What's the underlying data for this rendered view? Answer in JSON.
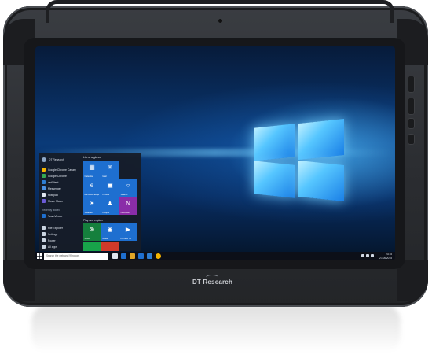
{
  "device": {
    "brand": "DT Research"
  },
  "start_menu": {
    "user": "DT Research",
    "apps": [
      {
        "label": "Google Chrome Canary",
        "color": "#f4b400"
      },
      {
        "label": "Google Chrome",
        "color": "#34a853"
      },
      {
        "label": "aetClient",
        "color": "#2d7dd2"
      },
      {
        "label": "Messenger",
        "color": "#4a90e2"
      },
      {
        "label": "Notepad",
        "color": "#dfe5ee"
      },
      {
        "label": "Movie Maker",
        "color": "#6b5bd6"
      }
    ],
    "recently_added_header": "Recently added",
    "recent_app": "TeamViewer",
    "system_items": [
      "File Explorer",
      "Settings",
      "Power",
      "All apps"
    ],
    "group1_header": "Life at a glance",
    "group2_header": "Play and explore",
    "tiles": [
      {
        "label": "Calendar",
        "glyph": "▦",
        "color": "#1e6fd0"
      },
      {
        "label": "Mail",
        "glyph": "✉",
        "color": "#1e6fd0"
      },
      {
        "label": "Microsoft Edge",
        "glyph": "e",
        "color": "#1e6fd0"
      },
      {
        "label": "Photos",
        "glyph": "▣",
        "color": "#1e6fd0"
      },
      {
        "label": "Search",
        "glyph": "○",
        "color": "#1e6fd0"
      },
      {
        "label": "Weather",
        "glyph": "☀",
        "color": "#1e6fd0"
      },
      {
        "label": "People",
        "glyph": "♟",
        "color": "#1e6fd0"
      },
      {
        "label": "OneNote",
        "glyph": "N",
        "color": "#8a2da8"
      },
      {
        "label": "Xbox",
        "glyph": "⊗",
        "color": "#15803d"
      },
      {
        "label": "Music",
        "glyph": "◉",
        "color": "#1e6fd0"
      },
      {
        "label": "Films & TV",
        "glyph": "▶",
        "color": "#1e6fd0"
      },
      {
        "label": "",
        "glyph": "",
        "color": "#18a34a"
      },
      {
        "label": "",
        "glyph": "",
        "color": "#d03a2a"
      }
    ]
  },
  "taskbar": {
    "search_placeholder": "Search the web and Windows",
    "icon_colors": [
      "#dfe5ee",
      "#1e6fd0",
      "#e0a526",
      "#1e6fd0",
      "#2d7dd2",
      "#f4b400"
    ],
    "time": "23:15",
    "date": "27/06/2015"
  },
  "colors": {
    "accent": "#1e6fd0",
    "desktop": "#0a3a78"
  }
}
